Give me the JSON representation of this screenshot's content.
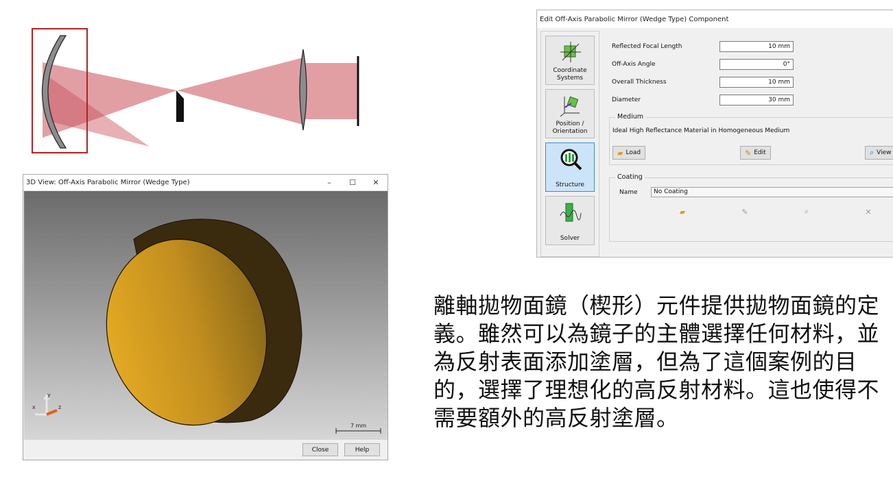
{
  "window_3d": {
    "title": "3D View: Off-Axis Parabolic Mirror (Wedge Type)",
    "minimize_glyph": "–",
    "maximize_glyph": "☐",
    "close_glyph": "✕",
    "axis_x": "x",
    "axis_y": "y",
    "axis_z": "z",
    "scale_label": "7 mm",
    "close_label": "Close",
    "help_label": "Help"
  },
  "dialog": {
    "title": "Edit Off-Axis Parabolic Mirror (Wedge Type) Component",
    "nav": [
      {
        "label": "Coordinate Systems"
      },
      {
        "label": "Position / Orientation"
      },
      {
        "label": "Structure"
      },
      {
        "label": "Solver"
      }
    ],
    "properties": [
      {
        "label": "Reflected Focal Length",
        "value": "10 mm"
      },
      {
        "label": "Off-Axis Angle",
        "value": "0°"
      },
      {
        "label": "Overall Thickness",
        "value": "10 mm"
      },
      {
        "label": "Diameter",
        "value": "30 mm"
      }
    ],
    "medium": {
      "title": "Medium",
      "value": "Ideal High Reflectance Material in Homogeneous Medium",
      "load_label": "Load",
      "edit_label": "Edit",
      "view_label": "View"
    },
    "coating": {
      "title": "Coating",
      "name_label": "Name",
      "name_value": "No Coating"
    }
  },
  "description": "離軸拋物面鏡（楔形）元件提供拋物面鏡的定義。雖然可以為鏡子的主體選擇任何材料，並為反射表面添加塗層，但為了這個案例的目的，選擇了理想化的高反射材料。這也使得不需要額外的高反射塗層。",
  "colors": {
    "beam": "#c8505a",
    "mirror": "#8c8c8c",
    "highlight_box": "#b22222",
    "disc_face": "#d9a224",
    "disc_side": "#3a2a0e",
    "active_nav": "#cce4f7"
  }
}
